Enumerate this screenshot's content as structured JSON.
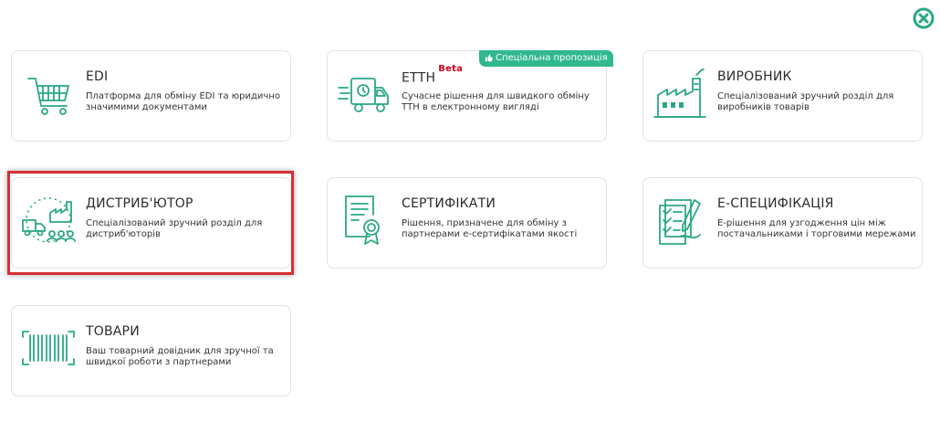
{
  "colors": {
    "accent": "#2aa786",
    "promo_bg": "#30b88f",
    "beta": "#d0021b",
    "highlight": "#d33035"
  },
  "close": {
    "icon": "close-icon"
  },
  "cards": {
    "edi": {
      "title": "EDI",
      "desc": "Платформа для обміну EDI та юридично значимими документами",
      "icon": "shopping-cart-icon"
    },
    "etth": {
      "title": "ЕТТН",
      "beta": "Beta",
      "desc": "Сучасне рішення для швидкого обміну ТТН в електронному вигляді",
      "promo": "Спеціальна пропозиція",
      "icon": "delivery-truck-icon"
    },
    "manufacturer": {
      "title": "ВИРОБНИК",
      "desc": "Спеціалізований зручний розділ для виробників товарів",
      "icon": "factory-icon"
    },
    "distributor": {
      "title": "ДИСТРИБ'ЮТОР",
      "desc": "Спеціалізований зручний розділ для дистриб'юторів",
      "icon": "distribution-icon"
    },
    "certificates": {
      "title": "СЕРТИФІКАТИ",
      "desc": "Рішення, призначене для обміну з партнерами е-сертифікатами якості",
      "icon": "certificate-icon"
    },
    "especification": {
      "title": "Е-СПЕЦИФІКАЦІЯ",
      "desc": "Е-рішення для узгодження цін між постачальниками і торговими мережами",
      "icon": "document-checklist-icon"
    },
    "goods": {
      "title": "ТОВАРИ",
      "desc": "Ваш товарний довідник для зручної та швидкої роботи з партнерами",
      "icon": "barcode-icon"
    }
  }
}
